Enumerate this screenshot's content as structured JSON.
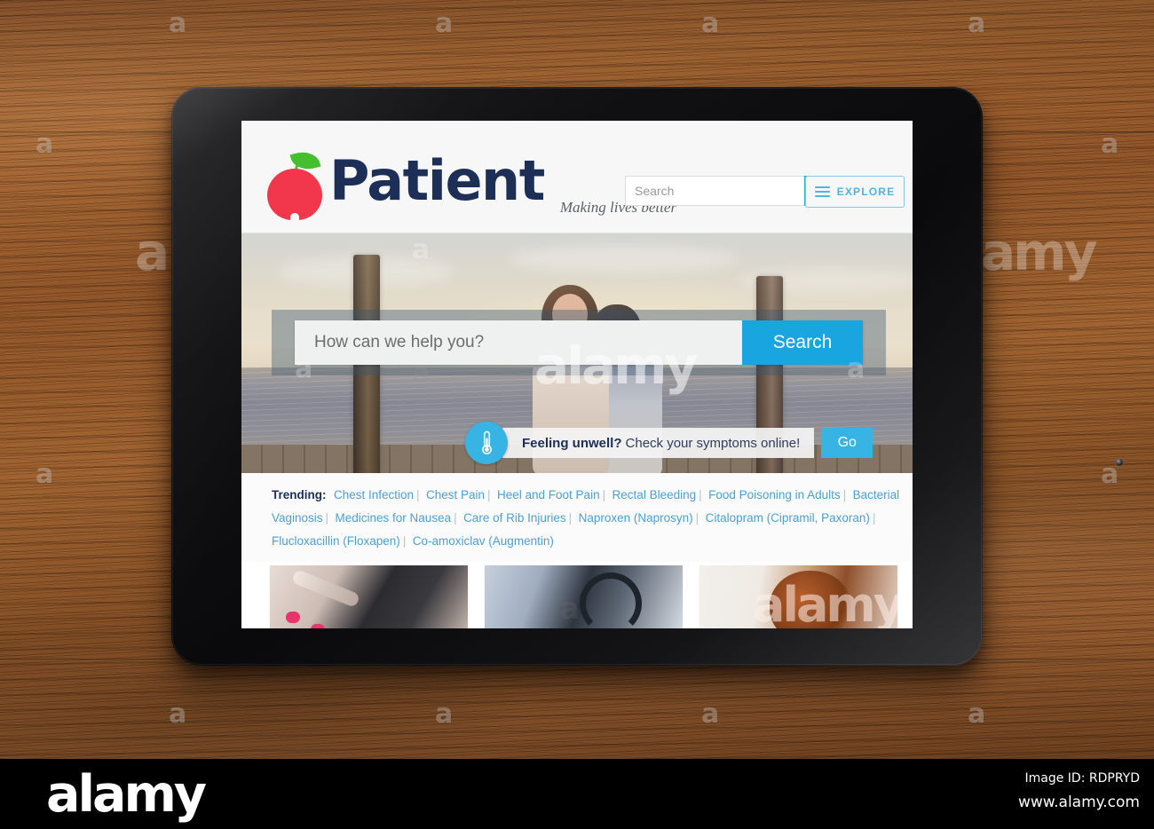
{
  "stock_photo": {
    "alamy_logo": "alamy",
    "image_id_label": "Image ID: RDPRYD",
    "website": "www.alamy.com",
    "watermark_letter": "a",
    "watermark_word": "alamy"
  },
  "device": {
    "name": "tablet",
    "home_button": "home-button",
    "front_camera": "front-camera"
  },
  "site": {
    "header": {
      "logo_icon": "red-apple-icon",
      "brand": "Patient",
      "tagline": "Making lives better",
      "search_placeholder": "Search",
      "search_value": "",
      "search_icon": "magnifier-icon",
      "explore_label": "EXPLORE",
      "explore_icon": "hamburger-menu-icon"
    },
    "hero": {
      "search_placeholder": "How can we help you?",
      "search_value": "",
      "search_button": "Search",
      "symptom_icon": "thermometer-icon",
      "symptom_strong": "Feeling unwell?",
      "symptom_text": "Check your symptoms online!",
      "go_button": "Go"
    },
    "trending": {
      "label": "Trending:",
      "separator": "|",
      "links": [
        "Chest Infection",
        "Chest Pain",
        "Heel and Foot Pain",
        "Rectal Bleeding",
        "Food Poisoning in Adults",
        "Bacterial Vaginosis",
        "Medicines for Nausea",
        "Care of Rib Injuries",
        "Naproxen (Naprosyn)",
        "Citalopram (Cipramil, Paxoran)",
        "Flucloxacillin (Floxapen)",
        "Co-amoxiclav (Augmentin)"
      ]
    },
    "cards": [
      {
        "name": "blood-glucose-test-card"
      },
      {
        "name": "blood-pressure-check-card"
      },
      {
        "name": "woman-with-glasses-card"
      }
    ]
  },
  "colors": {
    "brand_navy": "#1d2f56",
    "apple_red": "#f2374c",
    "apple_green": "#45bf2e",
    "accent_blue": "#29abe2",
    "hero_button_blue": "#19a5e0",
    "link_blue": "#4c9fd6",
    "desk_wood": "#8d5124"
  }
}
